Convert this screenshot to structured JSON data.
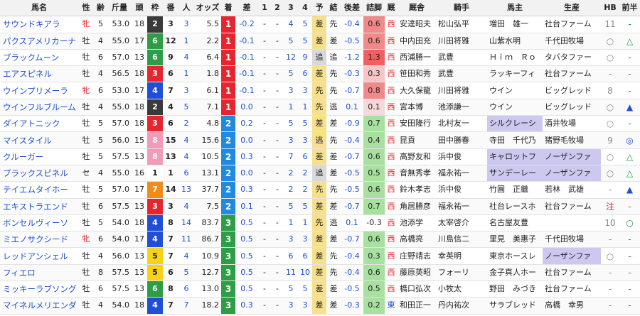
{
  "headers": [
    "馬名",
    "性",
    "齢",
    "斤量",
    "頭",
    "枠",
    "番",
    "人",
    "オッズ",
    "着",
    "差",
    "1",
    "2",
    "3",
    "4",
    "予",
    "結",
    "後差",
    "詰脚",
    "厩",
    "厩舎",
    "騎手",
    "馬主",
    "生産",
    "HB",
    "前半",
    "後半"
  ],
  "waku_colors": {
    "1": "#ffffff",
    "2": "#3a3a3a",
    "3": "#e8252f",
    "4": "#1f4fd8",
    "5": "#f7d317",
    "6": "#2e9e46",
    "7": "#f08c1e",
    "8": "#f29bb8"
  },
  "rows": [
    {
      "name": "サウンドキアラ",
      "sex": "牝",
      "age": "5",
      "kin": "53.0",
      "tou": "18",
      "waku": "2",
      "ban": "3",
      "ninki": "3",
      "odds": "5.5",
      "chaku": "1",
      "sa": "-0.2",
      "c1": "-",
      "c2": "-",
      "c3": "4",
      "c4": "5",
      "yo": "差",
      "ketsu": "先",
      "atosa": "-0.4",
      "tsume": "0.6",
      "tsume_color": "#f08a8a",
      "umaya": "西",
      "kyusha": "安達昭夫",
      "kishu": "松山弘平",
      "banushi": "増田　雄一",
      "seisan": "社台ファーム",
      "banushi_hl": false,
      "seisan_hl": false,
      "hb": "11",
      "zen": "-",
      "kou": "○"
    },
    {
      "name": "パクスアメリカーナ",
      "sex": "牡",
      "age": "4",
      "kin": "55.0",
      "tou": "17",
      "waku": "6",
      "ban": "12",
      "ninki": "1",
      "odds": "2.2",
      "chaku": "1",
      "sa": "-0.1",
      "c1": "-",
      "c2": "-",
      "c3": "5",
      "c4": "5",
      "yo": "差",
      "ketsu": "差",
      "atosa": "-0.5",
      "tsume": "0.6",
      "tsume_color": "#f08a8a",
      "umaya": "西",
      "kyusha": "中内田充",
      "kishu": "川田将雅",
      "banushi": "山紫水明",
      "seisan": "千代田牧場",
      "banushi_hl": false,
      "seisan_hl": false,
      "hb": "○",
      "zen": "△",
      "kou": "△"
    },
    {
      "name": "ブラックムーン",
      "sex": "牡",
      "age": "6",
      "kin": "57.0",
      "tou": "13",
      "waku": "6",
      "ban": "9",
      "ninki": "4",
      "odds": "6.4",
      "chaku": "1",
      "sa": "-0.1",
      "c1": "-",
      "c2": "-",
      "c3": "12",
      "c4": "9",
      "yo": "追",
      "ketsu": "追",
      "atosa": "-1.2",
      "tsume": "1.3",
      "tsume_color": "#f06060",
      "umaya": "西",
      "kyusha": "西浦勝一",
      "kishu": "武豊",
      "banushi": "Ｈｉｍ　Ｒｏ",
      "seisan": "タバタファー",
      "banushi_hl": false,
      "seisan_hl": false,
      "hb": "○",
      "zen": "-",
      "kou": "○"
    },
    {
      "name": "エアスピネル",
      "sex": "牡",
      "age": "4",
      "kin": "56.5",
      "tou": "18",
      "waku": "3",
      "ban": "6",
      "ninki": "1",
      "odds": "1.8",
      "chaku": "1",
      "sa": "-0.1",
      "c1": "-",
      "c2": "-",
      "c3": "5",
      "c4": "6",
      "yo": "差",
      "ketsu": "先",
      "atosa": "-0.3",
      "tsume": "0.3",
      "tsume_color": "#f6c6c6",
      "umaya": "西",
      "kyusha": "笹田和秀",
      "kishu": "武豊",
      "banushi": "ラッキーフィ",
      "seisan": "社台ファーム",
      "banushi_hl": false,
      "seisan_hl": false,
      "hb": "-",
      "zen": "-",
      "kou": "◎"
    },
    {
      "name": "ウインプリメーラ",
      "sex": "牝",
      "age": "6",
      "kin": "53.0",
      "tou": "17",
      "waku": "4",
      "ban": "7",
      "ninki": "3",
      "odds": "6.1",
      "chaku": "1",
      "sa": "-0.1",
      "c1": "-",
      "c2": "-",
      "c3": "3",
      "c4": "3",
      "yo": "先",
      "ketsu": "先",
      "atosa": "-0.7",
      "tsume": "0.8",
      "tsume_color": "#f08a8a",
      "umaya": "西",
      "kyusha": "大久保龍",
      "kishu": "川田将雅",
      "banushi": "ウイン",
      "seisan": "ビッグレッド",
      "banushi_hl": false,
      "seisan_hl": false,
      "hb": "8",
      "zen": "-",
      "kou": "○"
    },
    {
      "name": "ウインフルブルーム",
      "sex": "牡",
      "age": "4",
      "kin": "55.0",
      "tou": "18",
      "waku": "2",
      "ban": "4",
      "ninki": "5",
      "odds": "7.1",
      "chaku": "1",
      "sa": "0.0",
      "c1": "-",
      "c2": "-",
      "c3": "1",
      "c4": "1",
      "yo": "先",
      "ketsu": "逃",
      "atosa": "0.1",
      "tsume": "0.1",
      "tsume_color": "#f6d8d8",
      "umaya": "西",
      "kyusha": "宮本博",
      "kishu": "池添謙一",
      "banushi": "ウイン",
      "seisan": "ビッグレッド",
      "banushi_hl": false,
      "seisan_hl": false,
      "hb": "○",
      "zen": "▲",
      "kou": "-"
    },
    {
      "name": "ダイアトニック",
      "sex": "牡",
      "age": "5",
      "kin": "57.0",
      "tou": "18",
      "waku": "3",
      "ban": "6",
      "ninki": "2",
      "odds": "4.8",
      "chaku": "2",
      "sa": "0.2",
      "c1": "-",
      "c2": "-",
      "c3": "5",
      "c4": "5",
      "yo": "差",
      "ketsu": "差",
      "atosa": "-0.9",
      "tsume": "0.7",
      "tsume_color": "#a8e0a0",
      "umaya": "西",
      "kyusha": "安田隆行",
      "kishu": "北村友一",
      "banushi": "シルクレーシ",
      "seisan": "酒井牧場",
      "banushi_hl": true,
      "seisan_hl": false,
      "hb": "○",
      "zen": "-",
      "kou": "○"
    },
    {
      "name": "マイスタイル",
      "sex": "牡",
      "age": "5",
      "kin": "56.0",
      "tou": "15",
      "waku": "8",
      "ban": "15",
      "ninki": "4",
      "odds": "15.6",
      "chaku": "2",
      "sa": "0.0",
      "c1": "-",
      "c2": "-",
      "c3": "3",
      "c4": "3",
      "yo": "逃",
      "ketsu": "先",
      "atosa": "-0.4",
      "tsume": "0.4",
      "tsume_color": "#a8e0a0",
      "umaya": "西",
      "kyusha": "昆貢",
      "kishu": "田中勝春",
      "banushi": "寺田　千代乃",
      "seisan": "猪野毛牧場",
      "banushi_hl": false,
      "seisan_hl": false,
      "hb": "9",
      "zen": "◎",
      "kou": "○"
    },
    {
      "name": "クルーガー",
      "sex": "牡",
      "age": "5",
      "kin": "57.5",
      "tou": "13",
      "waku": "8",
      "ban": "13",
      "ninki": "4",
      "odds": "10.5",
      "chaku": "2",
      "sa": "0.3",
      "c1": "-",
      "c2": "-",
      "c3": "7",
      "c4": "6",
      "yo": "差",
      "ketsu": "差",
      "atosa": "-0.7",
      "tsume": "0.6",
      "tsume_color": "#a8e0a0",
      "umaya": "西",
      "kyusha": "高野友和",
      "kishu": "浜中俊",
      "banushi": "キャロットフ",
      "seisan": "ノーザンファ",
      "banushi_hl": true,
      "seisan_hl": true,
      "hb": "○",
      "zen": "△",
      "kou": "注"
    },
    {
      "name": "ブラックスピネル",
      "sex": "セ",
      "age": "4",
      "kin": "55.0",
      "tou": "16",
      "waku": "1",
      "ban": "1",
      "ninki": "6",
      "odds": "13.1",
      "chaku": "2",
      "sa": "0.0",
      "c1": "-",
      "c2": "-",
      "c3": "2",
      "c4": "2",
      "yo": "追",
      "ketsu": "差",
      "atosa": "-0.5",
      "tsume": "0.5",
      "tsume_color": "#a8e0a0",
      "umaya": "西",
      "kyusha": "音無秀孝",
      "kishu": "福永祐一",
      "banushi": "サンデーレー",
      "seisan": "ノーザンファ",
      "banushi_hl": true,
      "seisan_hl": true,
      "hb": "○",
      "zen": "△",
      "kou": "○"
    },
    {
      "name": "テイエムタイホー",
      "sex": "牡",
      "age": "5",
      "kin": "57.0",
      "tou": "17",
      "waku": "7",
      "ban": "14",
      "ninki": "13",
      "odds": "37.7",
      "chaku": "2",
      "sa": "0.3",
      "c1": "-",
      "c2": "-",
      "c3": "2",
      "c4": "2",
      "yo": "先",
      "ketsu": "先",
      "atosa": "-0.5",
      "tsume": "0.6",
      "tsume_color": "#a8e0a0",
      "umaya": "西",
      "kyusha": "鈴木孝志",
      "kishu": "浜中俊",
      "banushi": "竹園　正繼",
      "seisan": "若林　武雄",
      "banushi_hl": false,
      "seisan_hl": false,
      "hb": "-",
      "zen": "▲",
      "kou": "-"
    },
    {
      "name": "エキストラエンド",
      "sex": "牡",
      "age": "6",
      "kin": "57.5",
      "tou": "13",
      "waku": "3",
      "ban": "3",
      "ninki": "4",
      "odds": "7.5",
      "chaku": "2",
      "sa": "0.1",
      "c1": "-",
      "c2": "-",
      "c3": "5",
      "c4": "5",
      "yo": "差",
      "ketsu": "差",
      "atosa": "-0.7",
      "tsume": "0.7",
      "tsume_color": "#a8e0a0",
      "umaya": "西",
      "kyusha": "角居勝彦",
      "kishu": "福永祐一",
      "banushi": "社台レースホ",
      "seisan": "社台ファーム",
      "banushi_hl": false,
      "seisan_hl": false,
      "hb": "注",
      "zen": "-",
      "kou": "△"
    },
    {
      "name": "ボンセルヴィーソ",
      "sex": "牡",
      "age": "5",
      "kin": "54.0",
      "tou": "18",
      "waku": "4",
      "ban": "8",
      "ninki": "14",
      "odds": "83.7",
      "chaku": "3",
      "sa": "0.5",
      "c1": "-",
      "c2": "-",
      "c3": "1",
      "c4": "1",
      "yo": "先",
      "ketsu": "逃",
      "atosa": "0.1",
      "tsume": "-0.3",
      "tsume_color": "#ffffff",
      "umaya": "西",
      "kyusha": "池添学",
      "kishu": "太宰啓介",
      "banushi": "名古屋友豊",
      "seisan": "",
      "banushi_hl": false,
      "seisan_hl": false,
      "hb": "10",
      "zen": "○",
      "kou": "-"
    },
    {
      "name": "ミエノサクシード",
      "sex": "牝",
      "age": "6",
      "kin": "54.0",
      "tou": "17",
      "waku": "4",
      "ban": "7",
      "ninki": "11",
      "odds": "86.7",
      "chaku": "3",
      "sa": "0.5",
      "c1": "-",
      "c2": "-",
      "c3": "3",
      "c4": "3",
      "yo": "差",
      "ketsu": "差",
      "atosa": "-0.7",
      "tsume": "0.6",
      "tsume_color": "#a8e0a0",
      "umaya": "西",
      "kyusha": "高橋亮",
      "kishu": "川島信二",
      "banushi": "里見　美惠子",
      "seisan": "千代田牧場",
      "banushi_hl": false,
      "seisan_hl": false,
      "hb": "-",
      "zen": "-",
      "kou": "-"
    },
    {
      "name": "レッドアンシェル",
      "sex": "牡",
      "age": "4",
      "kin": "56.0",
      "tou": "13",
      "waku": "5",
      "ban": "7",
      "ninki": "4",
      "odds": "10.9",
      "chaku": "3",
      "sa": "0.5",
      "c1": "-",
      "c2": "-",
      "c3": "6",
      "c4": "6",
      "yo": "差",
      "ketsu": "先",
      "atosa": "-0.4",
      "tsume": "0.3",
      "tsume_color": "#a8e0a0",
      "umaya": "西",
      "kyusha": "庄野靖志",
      "kishu": "幸英明",
      "banushi": "東京ホースレ",
      "seisan": "ノーザンファ",
      "banushi_hl": false,
      "seisan_hl": true,
      "hb": "○",
      "zen": "-",
      "kou": "○"
    },
    {
      "name": "フィエロ",
      "sex": "牡",
      "age": "8",
      "kin": "57.5",
      "tou": "13",
      "waku": "5",
      "ban": "6",
      "ninki": "5",
      "odds": "12.7",
      "chaku": "3",
      "sa": "0.5",
      "c1": "-",
      "c2": "-",
      "c3": "11",
      "c4": "10",
      "yo": "差",
      "ketsu": "先",
      "atosa": "-0.4",
      "tsume": "0.6",
      "tsume_color": "#a8e0a0",
      "umaya": "西",
      "kyusha": "藤原英昭",
      "kishu": "フォーリ",
      "banushi": "金子真人ホー",
      "seisan": "社台ファーム",
      "banushi_hl": false,
      "seisan_hl": false,
      "hb": "-",
      "zen": "-",
      "kou": "△"
    },
    {
      "name": "ミッキーラブソング",
      "sex": "牡",
      "age": "6",
      "kin": "57.5",
      "tou": "13",
      "waku": "6",
      "ban": "8",
      "ninki": "6",
      "odds": "13.0",
      "chaku": "3",
      "sa": "0.5",
      "c1": "-",
      "c2": "-",
      "c3": "5",
      "c4": "5",
      "yo": "差",
      "ketsu": "差",
      "atosa": "-0.5",
      "tsume": "0.5",
      "tsume_color": "#a8e0a0",
      "umaya": "西",
      "kyusha": "橋口弘次",
      "kishu": "小牧太",
      "banushi": "野田　みづき",
      "seisan": "社台ファーム",
      "banushi_hl": false,
      "seisan_hl": false,
      "hb": "-",
      "zen": "-",
      "kou": "☆"
    },
    {
      "name": "マイネルメリエンダ",
      "sex": "牡",
      "age": "4",
      "kin": "54.0",
      "tou": "18",
      "waku": "4",
      "ban": "7",
      "ninki": "7",
      "odds": "18.2",
      "chaku": "3",
      "sa": "0.3",
      "c1": "-",
      "c2": "-",
      "c3": "3",
      "c4": "3",
      "yo": "差",
      "ketsu": "差",
      "atosa": "-0.3",
      "tsume": "0.2",
      "tsume_color": "#a8e0a0",
      "umaya": "東",
      "kyusha": "和田正一",
      "kishu": "丹内祐次",
      "banushi": "サラブレッド",
      "seisan": "高橋　幸男",
      "banushi_hl": false,
      "seisan_hl": false,
      "hb": "-",
      "zen": "-",
      "kou": "-"
    }
  ]
}
